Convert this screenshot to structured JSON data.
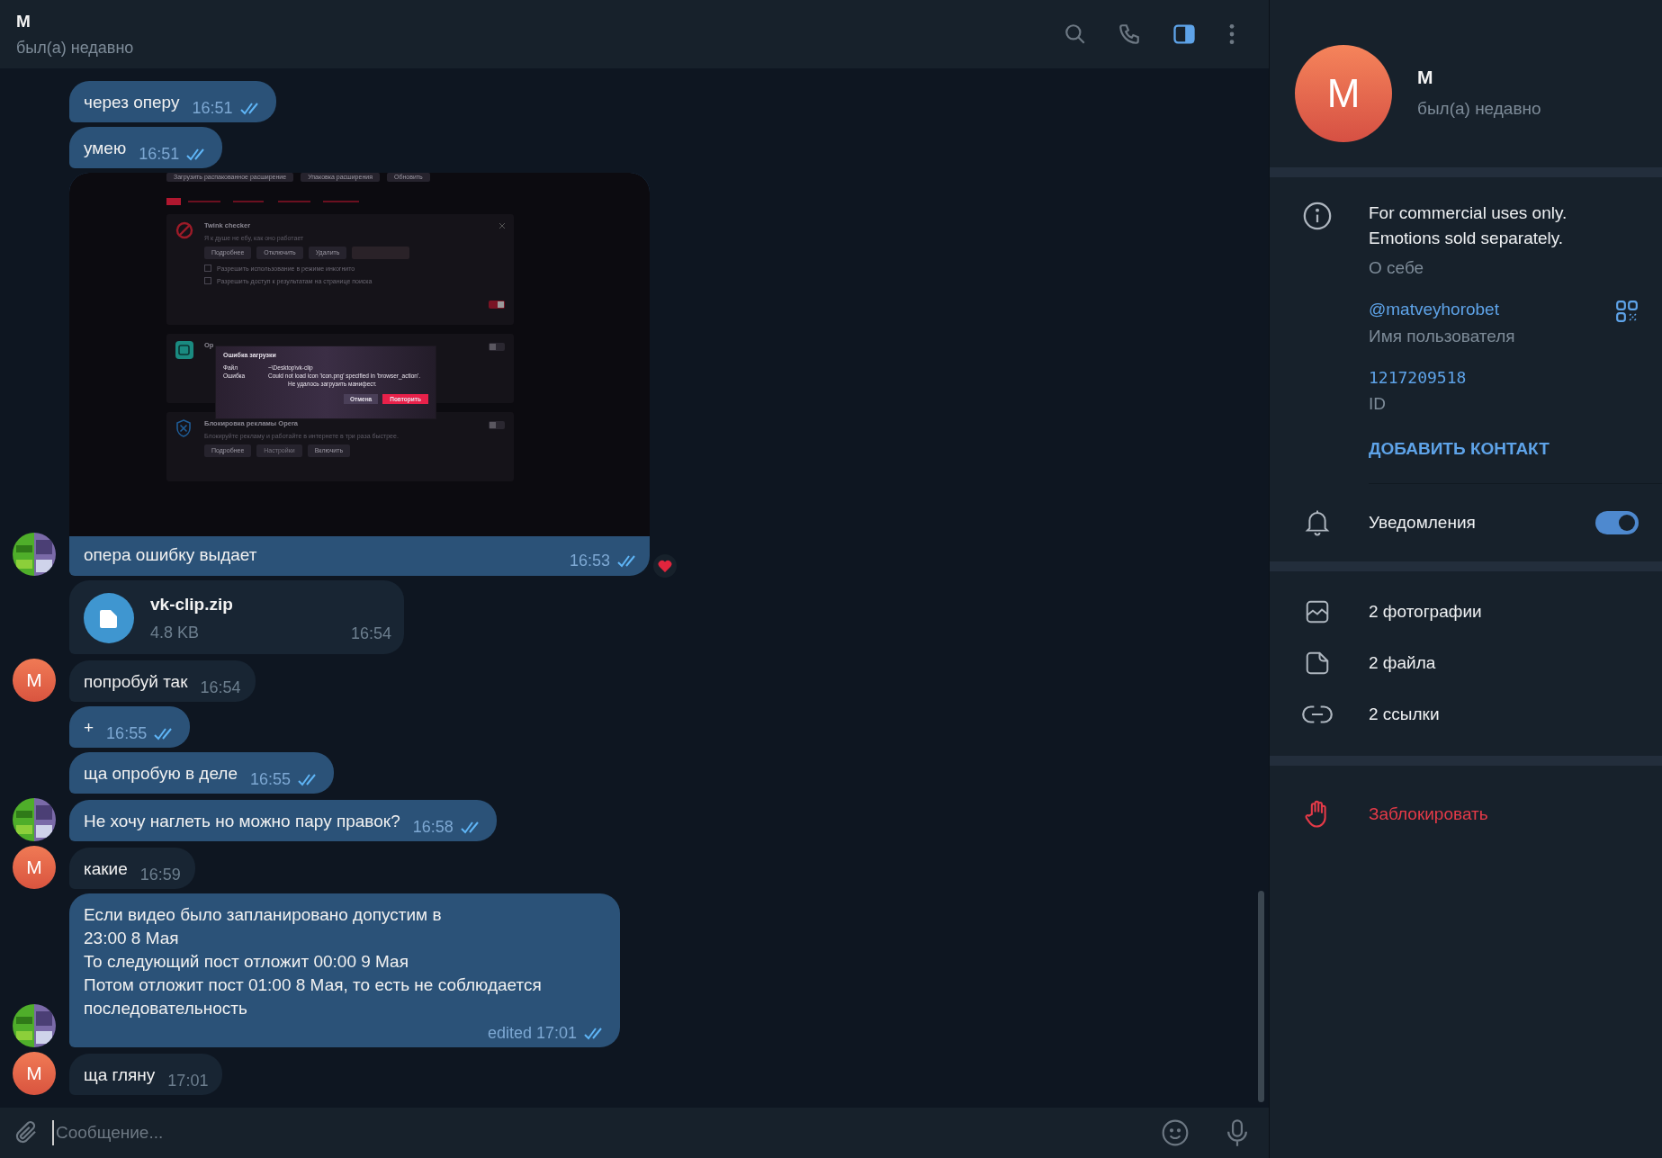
{
  "header": {
    "title": "M",
    "status": "был(а) недавно",
    "panel_open": true
  },
  "messages": [
    {
      "kind": "text",
      "outgoing": true,
      "text": "через оперу",
      "time": "16:51",
      "read": true
    },
    {
      "kind": "text",
      "outgoing": true,
      "text": "умею",
      "time": "16:51",
      "read": true
    },
    {
      "kind": "image",
      "outgoing": true,
      "text": "опера ошибку выдает",
      "time": "16:53",
      "read": true,
      "avatar": {
        "kind": "photo"
      },
      "reacted": true
    },
    {
      "kind": "file",
      "outgoing": false,
      "file_name": "vk-clip.zip",
      "size": "4.8 KB",
      "time": "16:54"
    },
    {
      "kind": "text",
      "outgoing": false,
      "text": "попробуй так",
      "time": "16:54",
      "avatar": {
        "kind": "letter",
        "text": "M"
      }
    },
    {
      "kind": "text",
      "outgoing": true,
      "text": "+",
      "time": "16:55",
      "read": true
    },
    {
      "kind": "text",
      "outgoing": true,
      "text": "ща опробую в деле",
      "time": "16:55",
      "read": true
    },
    {
      "kind": "text",
      "outgoing": true,
      "text": "Не хочу наглеть но можно пару правок?",
      "time": "16:58",
      "read": true,
      "avatar": {
        "kind": "photo"
      }
    },
    {
      "kind": "text",
      "outgoing": false,
      "text": "какие",
      "time": "16:59",
      "avatar": {
        "kind": "letter",
        "text": "M"
      }
    },
    {
      "kind": "text",
      "outgoing": true,
      "text": "Если видео было запланировано допустим в\n23:00 8 Мая\nТо следующий пост отложит 00:00 9 Мая\nПотом отложит пост 01:00 8 Мая, то есть не соблюдается последовательность",
      "time": "edited 17:01",
      "read": true,
      "avatar": {
        "kind": "photo"
      }
    },
    {
      "kind": "text",
      "outgoing": false,
      "text": "ща гляну",
      "time": "17:01",
      "avatar": {
        "kind": "letter",
        "text": "M"
      }
    }
  ],
  "screenshot": {
    "top_buttons": [
      "Загрузить распакованное расширение",
      "Упаковка расширения",
      "Обновить"
    ],
    "extensions": [
      {
        "name": "Twink checker",
        "description": "Я к душе не ебу, как оно работает",
        "buttons": [
          {
            "label": "Подробнее",
            "disabled": false
          },
          {
            "label": "Отключить",
            "disabled": false
          },
          {
            "label": "Удалить",
            "disabled": false
          }
        ],
        "options": [
          {
            "label": "Разрешить использование в режиме инкогнито",
            "checked": false
          },
          {
            "label": "Разрешить доступ к результатам на странице поиска",
            "checked": false
          }
        ],
        "enabled": true
      },
      {
        "name": "Op",
        "enabled": false
      },
      {
        "name": "Блокировка рекламы Opera",
        "description": "Блокируйте рекламу и работайте в интернете в три раза быстрее.",
        "buttons": [
          {
            "label": "Подробнее",
            "disabled": false
          },
          {
            "label": "Настройки",
            "disabled": true
          },
          {
            "label": "Включить",
            "disabled": false
          }
        ],
        "enabled": false
      }
    ],
    "dialog": {
      "title": "Ошибка загрузки",
      "rows": [
        {
          "label": "Файл",
          "value": "~\\Desktop\\vk-clip"
        },
        {
          "label": "Ошибка",
          "value": "Could not load icon 'icon.png' specified in 'browser_action'."
        }
      ],
      "note": "Не удалось загрузить манифест.",
      "buttons": [
        "Отмена",
        "Повторить"
      ]
    }
  },
  "composer": {
    "placeholder": "Сообщение..."
  },
  "profile": {
    "letter": "M",
    "name": "M",
    "status": "был(а) недавно",
    "bio": "For commercial uses only.\nEmotions sold separately.",
    "bio_label": "О себе",
    "username": "@matveyhorobet",
    "username_label": "Имя пользователя",
    "id": "1217209518",
    "id_label": "ID",
    "add_contact": "ДОБАВИТЬ КОНТАКТ",
    "notifications": {
      "label": "Уведомления",
      "on": true
    },
    "media": [
      {
        "kind": "photos",
        "label": "2 фотографии"
      },
      {
        "kind": "files",
        "label": "2 файла"
      },
      {
        "kind": "links",
        "label": "2 ссылки"
      }
    ],
    "block": "Заблокировать"
  }
}
